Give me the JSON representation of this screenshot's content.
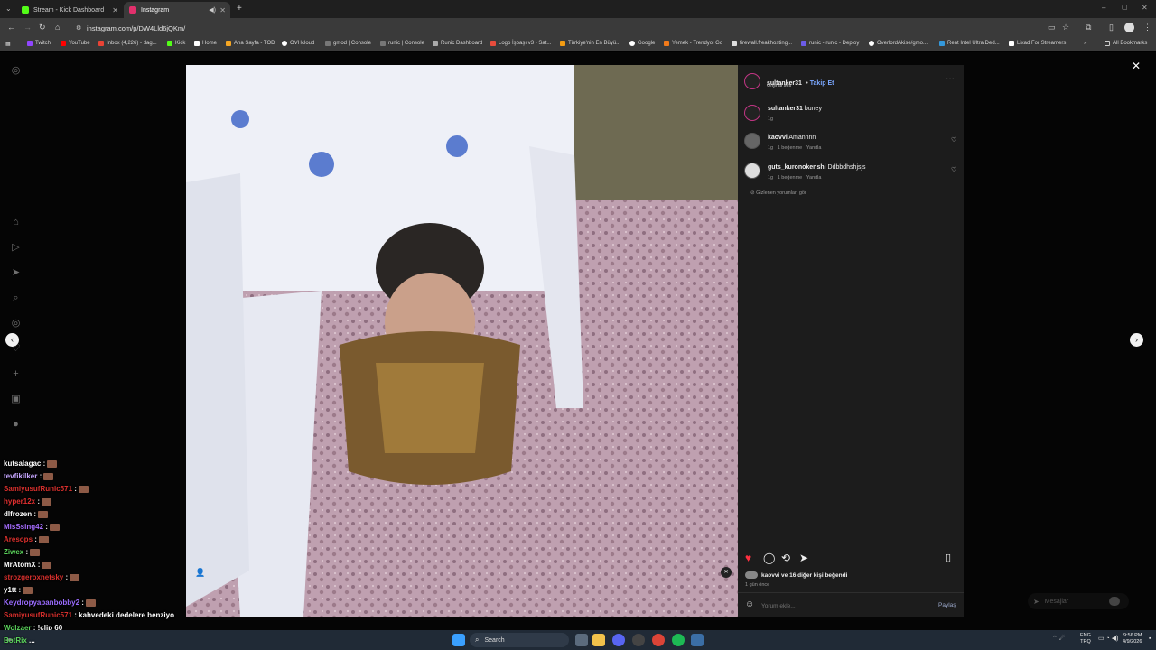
{
  "tabs": [
    {
      "title": "Stream - Kick Dashboard",
      "favicon_color": "#53fc18"
    },
    {
      "title": "Instagram",
      "favicon_color": "#e1306c"
    }
  ],
  "address": {
    "url": "instagram.com/p/DW4Lld6jQKm/"
  },
  "bookmarks": [
    "Twitch",
    "YouTube",
    "Inbox (4,226) - dag...",
    "Kick",
    "Home",
    "Ana Sayfa - TOD",
    "OVHcloud",
    "gmod | Console",
    "runic | Console",
    "Runic Dashboard",
    "Logo İşbaşı v3 - Sat...",
    "Türkiye'nin En Büyü...",
    "Google",
    "Yemek - Trendyol Go",
    "firewall.freakhosting...",
    "runic - runic - Deploy",
    "OverlordAkise/gmo...",
    "Rent Intel Ultra Ded...",
    "Lixad For Streamers"
  ],
  "bookmarks_all": "All Bookmarks",
  "post": {
    "author": "sultanker31",
    "follow": "Takip Et",
    "audio": "Orijinal ses",
    "caption_user": "sultanker31",
    "caption_text": "buney",
    "caption_time": "1g",
    "comments": [
      {
        "user": "kaovvi",
        "text": "Amannnn",
        "time": "1g",
        "likes": "1 beğenme",
        "reply": "Yanıtla"
      },
      {
        "user": "guts_kuronokenshi",
        "text": "Ddbbdhshjsjs",
        "time": "1g",
        "likes": "1 beğenme",
        "reply": "Yanıtla"
      }
    ],
    "hidden_comments": "Gizlenen yorumları gör",
    "liked_by": "kaovvi ve 16 diğer kişi beğendi",
    "posted_ago": "1 gün önce",
    "comment_placeholder": "Yorum ekle...",
    "share": "Paylaş"
  },
  "messages": "Mesajlar",
  "chat": [
    {
      "user": "kutsalagac",
      "color": "#ffffff",
      "text": ""
    },
    {
      "user": "tevfikilker",
      "color": "#c6a6ff",
      "text": ""
    },
    {
      "user": "SamiyusufRunic571",
      "color": "#d9302d",
      "text": ""
    },
    {
      "user": "hyper12x",
      "color": "#e03030",
      "text": ""
    },
    {
      "user": "dlfrozen",
      "color": "#ffffff",
      "text": ""
    },
    {
      "user": "MisSsing42",
      "color": "#a66dff",
      "text": ""
    },
    {
      "user": "Aresops",
      "color": "#d9302d",
      "text": ""
    },
    {
      "user": "Ziwex",
      "color": "#5cd65c",
      "text": ""
    },
    {
      "user": "MrAtomX",
      "color": "#ffffff",
      "text": ""
    },
    {
      "user": "strozgeroxnetsky",
      "color": "#d9302d",
      "text": ""
    },
    {
      "user": "y1tt",
      "color": "#ffffff",
      "text": ""
    },
    {
      "user": "Keydropyapanbobby2",
      "color": "#9b6cff",
      "text": ""
    },
    {
      "user": "SamiyusufRunic571",
      "color": "#d9302d",
      "text": "kahvedeki dedelere benziyo"
    },
    {
      "user": "Wolzaer",
      "color": "#5cd65c",
      "text": "!clip 60"
    },
    {
      "user": "BotRix",
      "color": "#5cd65c",
      "text": "..."
    }
  ],
  "taskbar": {
    "search": "Search",
    "lang1": "ENG",
    "lang2": "TRQ",
    "time": "9:56 PM",
    "date": "4/9/2026"
  }
}
